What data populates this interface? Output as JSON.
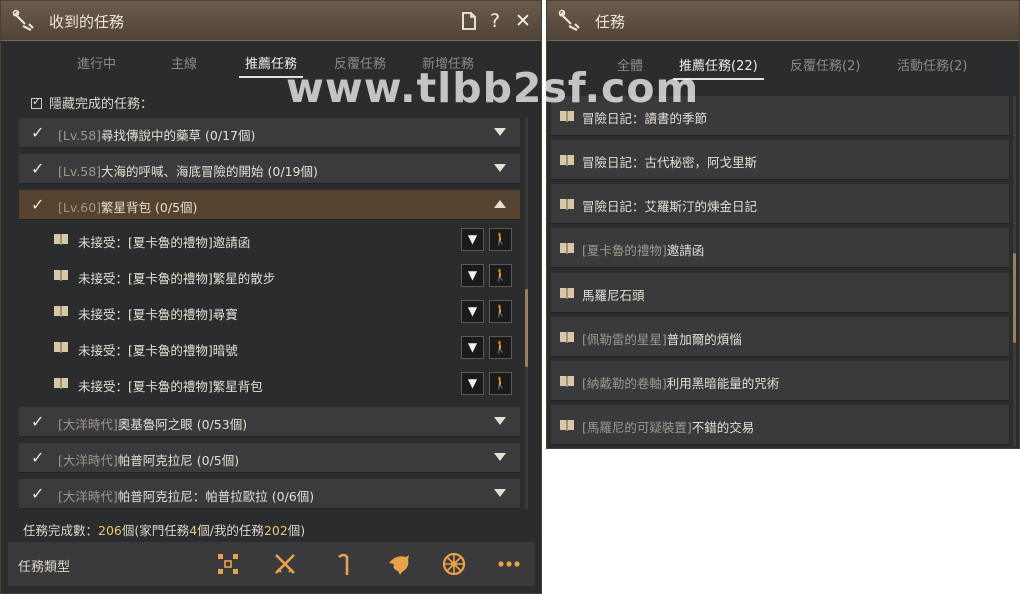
{
  "watermark": "www.tlbb2sf.com",
  "left": {
    "title": "收到的任務",
    "controls": {
      "help": "?",
      "close": "✕"
    },
    "tabs": [
      {
        "label": "進行中",
        "active": false
      },
      {
        "label": "主線",
        "active": false
      },
      {
        "label": "推薦任務",
        "active": true
      },
      {
        "label": "反覆任務",
        "active": false
      },
      {
        "label": "新增任務",
        "active": false
      }
    ],
    "hide_completed_label": "隱藏完成的任務：",
    "quests": [
      {
        "prefix": "[Lv.58]",
        "name": "尋找傳說中的藥草",
        "progress": "(0/17個)",
        "expanded": false
      },
      {
        "prefix": "[Lv.58]",
        "name": "大海的呼喊、海底冒險的開始",
        "progress": "(0/19個)",
        "expanded": false
      },
      {
        "prefix": "[Lv.60]",
        "name": "繁星背包",
        "progress": "(0/5個)",
        "expanded": true
      },
      {
        "prefix": "[大洋時代]",
        "name": "奧基魯阿之眼",
        "progress": "(0/53個)",
        "expanded": false
      },
      {
        "prefix": "[大洋時代]",
        "name": "帕普阿克拉尼",
        "progress": "(0/5個)",
        "expanded": false
      },
      {
        "prefix": "[大洋時代]",
        "name": "帕普阿克拉尼：帕普拉歐拉",
        "progress": "(0/6個)",
        "expanded": false
      }
    ],
    "subquests": [
      "未接受：[夏卡魯的禮物]邀請函",
      "未接受：[夏卡魯的禮物]繁星的散步",
      "未接受：[夏卡魯的禮物]尋寶",
      "未接受：[夏卡魯的禮物]暗號",
      "未接受：[夏卡魯的禮物]繁星背包"
    ],
    "summary": {
      "label": "任務完成數：",
      "total": "206",
      "part1": "個(家門任務",
      "family": "4",
      "part2": "個/我的任務",
      "mine": "202",
      "part3": "個)"
    },
    "bottom_title": "任務類型",
    "type_icons": [
      "grid-icon",
      "crossed-swords-icon",
      "fishing-rod-icon",
      "dolphin-icon",
      "ship-wheel-icon",
      "more-icon"
    ],
    "accent_color": "#e8c86a"
  },
  "right": {
    "title": "任務",
    "tabs": [
      {
        "label": "全體",
        "active": false
      },
      {
        "label": "推薦任務(22)",
        "active": true
      },
      {
        "label": "反覆任務(2)",
        "active": false
      },
      {
        "label": "活動任務(2)",
        "active": false
      }
    ],
    "items": [
      {
        "text": "冒險日記：讀書的季節",
        "dim_prefix": ""
      },
      {
        "text": "冒險日記：古代秘密，阿戈里斯",
        "dim_prefix": ""
      },
      {
        "text": "冒險日記：艾羅斯汀的煉金日記",
        "dim_prefix": ""
      },
      {
        "text": "邀請函",
        "dim_prefix": "[夏卡魯的禮物]"
      },
      {
        "text": "馬羅尼石頭",
        "dim_prefix": ""
      },
      {
        "text": "普加爾的煩惱",
        "dim_prefix": "[佩勒雷的星星]"
      },
      {
        "text": "利用黑暗能量的咒術",
        "dim_prefix": "[納戴勒的卷軸]"
      },
      {
        "text": "不錯的交易",
        "dim_prefix": "[馬羅尼的可疑裝置]"
      }
    ]
  }
}
